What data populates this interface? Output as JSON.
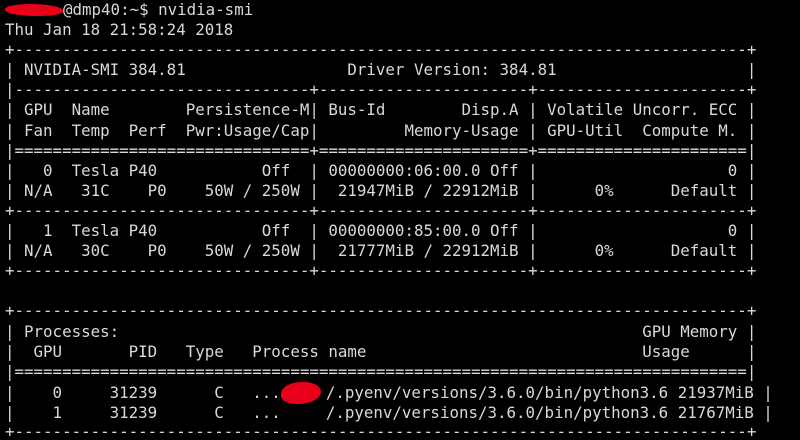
{
  "prompt": {
    "host_suffix": "@dmp40:~$ ",
    "command": "nvidia-smi"
  },
  "timestamp": "Thu Jan 18 21:58:24 2018",
  "table": {
    "border_top": "+-----------------------------------------------------------------------------+",
    "version_row": "| NVIDIA-SMI 384.81                 Driver Version: 384.81                    |",
    "header_sep": "|-------------------------------+----------------------+----------------------+",
    "header_row_1": "| GPU  Name        Persistence-M| Bus-Id        Disp.A | Volatile Uncorr. ECC |",
    "header_row_2": "| Fan  Temp  Perf  Pwr:Usage/Cap|         Memory-Usage | GPU-Util  Compute M. |",
    "double_sep": "|===============================+======================+======================|",
    "gpu_sep": "+-------------------------------+----------------------+----------------------+",
    "gpus": [
      {
        "row_1": "|   0  Tesla P40           Off  | 00000000:06:00.0 Off |                    0 |",
        "row_2": "| N/A   31C    P0    50W / 250W |  21947MiB / 22912MiB |      0%      Default |"
      },
      {
        "row_1": "|   1  Tesla P40           Off  | 00000000:85:00.0 Off |                    0 |",
        "row_2": "| N/A   30C    P0    50W / 250W |  21777MiB / 22912MiB |      0%      Default |"
      }
    ]
  },
  "processes": {
    "border_top": "+-----------------------------------------------------------------------------+",
    "title_row": "| Processes:                                                       GPU Memory |",
    "header_row": "|  GPU       PID   Type   Process name                             Usage      |",
    "double_sep": "|=============================================================================|",
    "rows": [
      {
        "prefix": "|    0     31239      C   ...",
        "suffix": "/.pyenv/versions/3.6.0/bin/python3.6 21937MiB |"
      },
      {
        "prefix": "|    1     31239      C   ...",
        "suffix": "/.pyenv/versions/3.6.0/bin/python3.6 21767MiB |"
      }
    ],
    "border_bottom": "+-----------------------------------------------------------------------------+"
  },
  "colors": {
    "background": "#000000",
    "text": "#d9d9d9",
    "redaction": "#e8001a"
  }
}
